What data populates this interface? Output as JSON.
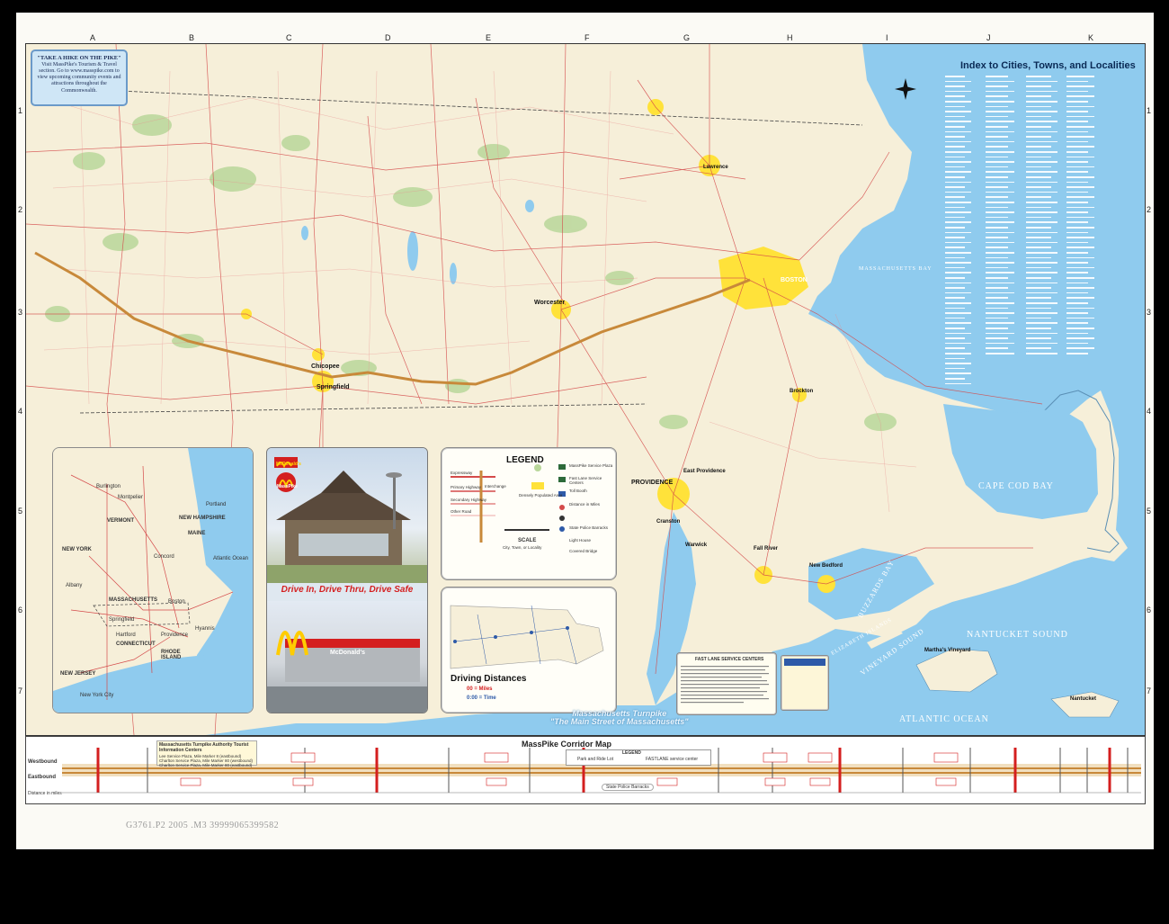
{
  "hike_box": {
    "title": "\"TAKE A HIKE ON THE PIKE\"",
    "body": "Visit MassPike's Tourism & Travel section. Go to www.masspike.com to view upcoming community events and attractions throughout the Commonwealth."
  },
  "index": {
    "title": "Index to Cities, Towns, and Localities"
  },
  "grid": {
    "columns": [
      "A",
      "B",
      "C",
      "D",
      "E",
      "F",
      "G",
      "H",
      "I",
      "J",
      "K"
    ],
    "rows": [
      "1",
      "2",
      "3",
      "4",
      "5",
      "6",
      "7"
    ]
  },
  "cities": {
    "boston": "BOSTON",
    "worcester": "Worcester",
    "springfield": "Springfield",
    "providence": "PROVIDENCE",
    "east_providence": "East Providence",
    "chicopee": "Chicopee",
    "lawrence": "Lawrence",
    "brockton": "Brockton",
    "fall_river": "Fall River",
    "new_bedford": "New Bedford",
    "cranston": "Cranston",
    "warwick": "Warwick",
    "marthas_vineyard": "Martha's Vineyard",
    "nantucket": "Nantucket"
  },
  "water": {
    "atlantic": "ATLANTIC OCEAN",
    "cape_cod_bay": "CAPE COD BAY",
    "nantucket_sound": "NANTUCKET SOUND",
    "massachusetts_bay": "MASSACHUSETTS BAY",
    "buzzards_bay": "BUZZARDS BAY",
    "vineyard_sound": "VINEYARD SOUND",
    "elizabeth_islands": "ELIZABETH ISLANDS"
  },
  "inset": {
    "states": [
      "MAINE",
      "VERMONT",
      "NEW HAMPSHIRE",
      "NEW YORK",
      "MASSACHUSETTS",
      "CONNECTICUT",
      "RHODE ISLAND",
      "NEW JERSEY"
    ],
    "places": [
      "Albany",
      "Springfield",
      "Boston",
      "Portland",
      "Burlington",
      "Montpelier",
      "Concord",
      "Hartford",
      "Providence",
      "Hyannis",
      "New York City"
    ],
    "ocean": "Atlantic Ocean"
  },
  "mcdonalds": {
    "brand": "McDonald's",
    "partner": "MassPike",
    "slogan": "Drive In, Drive Thru, Drive Safe",
    "sign": "McDonald's"
  },
  "legend": {
    "title": "LEGEND",
    "items": [
      "Expressway",
      "Primary Highway",
      "Secondary Highway",
      "Other Road",
      "City, Town, or Locality",
      "Interchange",
      "MassPike Service Plaza",
      "Fast Lane Service Centers",
      "Toll Booth",
      "Distance in Miles",
      "Densely Populated Area",
      "State Police Barracks",
      "Light House",
      "Covered Bridge"
    ],
    "scale_label": "SCALE"
  },
  "driving": {
    "title": "Driving Distances",
    "miles": "00 = Miles",
    "time": "0:00 = Time"
  },
  "fastlane": {
    "title": "FAST LANE SERVICE CENTERS"
  },
  "turnpike": {
    "line1": "Massachusetts Turnpike",
    "line2": "\"The Main Street of Massachusetts\""
  },
  "corridor": {
    "title": "MassPike Corridor Map",
    "westbound": "Westbound",
    "eastbound": "Eastbound",
    "legend_title": "LEGEND",
    "legend_items": [
      "Park and Ride Lot",
      "FASTLANE service center",
      "State Police Barracks"
    ],
    "info_title": "Massachusetts Turnpike Authority Tourist Information Centers",
    "info_lines": [
      "Lee Service Plaza, Mile Marker 8 (eastbound)",
      "Charlton Service Plaza, Mile Marker 80 (westbound)",
      "Charlton Service Plaza, Mile Marker 80 (eastbound)"
    ],
    "mile_label": "Distance in miles"
  },
  "catalog": {
    "note": "G3761.P2 2005 .M3 39999065399582"
  },
  "colors": {
    "ocean": "#8fcbee",
    "land": "#f6efd9",
    "turnpike": "#c8893a",
    "roads": "#d44a4a",
    "urban": "#ffe23a",
    "forest": "#b9d79a"
  }
}
